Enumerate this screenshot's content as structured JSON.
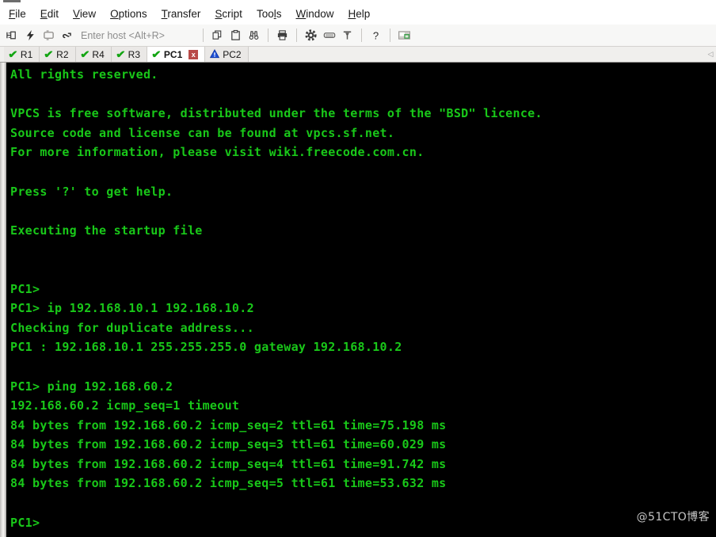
{
  "window": {
    "title_sliver": ""
  },
  "menubar": {
    "items": [
      {
        "label": "File",
        "accel": "F"
      },
      {
        "label": "Edit",
        "accel": "E"
      },
      {
        "label": "View",
        "accel": "V"
      },
      {
        "label": "Options",
        "accel": "O"
      },
      {
        "label": "Transfer",
        "accel": "T"
      },
      {
        "label": "Script",
        "accel": "S"
      },
      {
        "label": "Tools",
        "accel": "l"
      },
      {
        "label": "Window",
        "accel": "W"
      },
      {
        "label": "Help",
        "accel": "H"
      }
    ]
  },
  "toolbar": {
    "connect_icon": "connect-icon",
    "quick_connect_icon": "lightning-icon",
    "reconnect_icon": "reconnect-all-icon",
    "disconnect_icon": "disconnect-icon",
    "host_placeholder": "Enter host <Alt+R>",
    "copy_icon": "copy-icon",
    "paste_icon": "paste-icon",
    "find_icon": "binoculars-icon",
    "print_icon": "print-icon",
    "settings_icon": "gear-icon",
    "keymap_icon": "keyboard-icon",
    "filter_icon": "filter-icon",
    "help_icon": "question-icon",
    "about_icon": "about-icon"
  },
  "tabs": {
    "items": [
      {
        "label": "R1",
        "status": "connected",
        "active": false,
        "closable": false
      },
      {
        "label": "R2",
        "status": "connected",
        "active": false,
        "closable": false
      },
      {
        "label": "R4",
        "status": "connected",
        "active": false,
        "closable": false
      },
      {
        "label": "R3",
        "status": "connected",
        "active": false,
        "closable": false
      },
      {
        "label": "PC1",
        "status": "connected",
        "active": true,
        "closable": true
      },
      {
        "label": "PC2",
        "status": "warning",
        "active": false,
        "closable": false
      }
    ],
    "close_glyph": "x",
    "scroll_right_glyph": "◁"
  },
  "terminal": {
    "background_color": "#000000",
    "text_color": "#19c819",
    "lines": [
      "All rights reserved.",
      "",
      "VPCS is free software, distributed under the terms of the \"BSD\" licence.",
      "Source code and license can be found at vpcs.sf.net.",
      "For more information, please visit wiki.freecode.com.cn.",
      "",
      "Press '?' to get help.",
      "",
      "Executing the startup file",
      "",
      "",
      "PC1>",
      "PC1> ip 192.168.10.1 192.168.10.2",
      "Checking for duplicate address...",
      "PC1 : 192.168.10.1 255.255.255.0 gateway 192.168.10.2",
      "",
      "PC1> ping 192.168.60.2",
      "192.168.60.2 icmp_seq=1 timeout",
      "84 bytes from 192.168.60.2 icmp_seq=2 ttl=61 time=75.198 ms",
      "84 bytes from 192.168.60.2 icmp_seq=3 ttl=61 time=60.029 ms",
      "84 bytes from 192.168.60.2 icmp_seq=4 ttl=61 time=91.742 ms",
      "84 bytes from 192.168.60.2 icmp_seq=5 ttl=61 time=53.632 ms",
      "",
      "PC1>"
    ]
  },
  "watermark": {
    "text": "@51CTO博客"
  }
}
